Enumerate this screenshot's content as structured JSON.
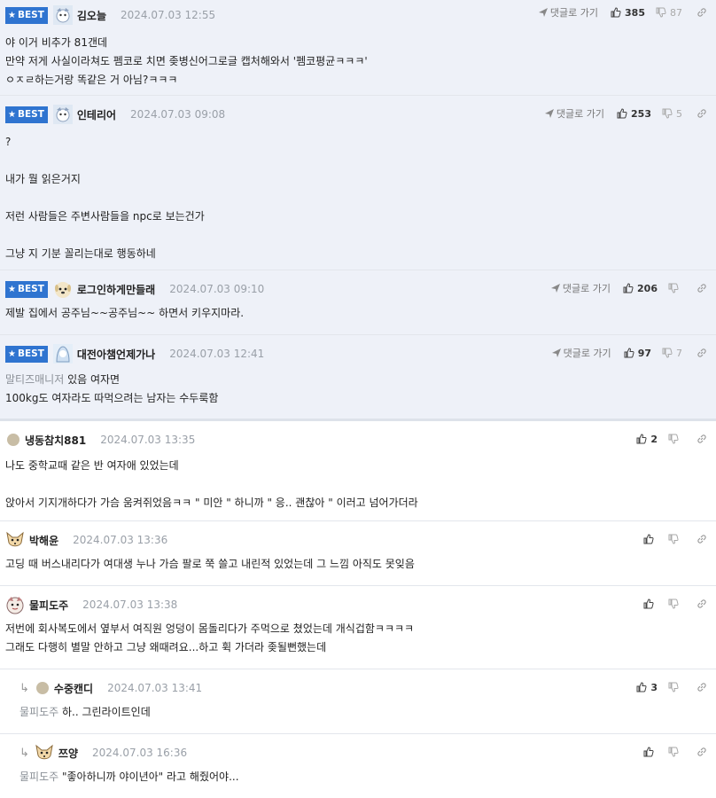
{
  "badge_label": "BEST",
  "reply_label": "댓글로 가기",
  "comments": [
    {
      "nick": "김오늘",
      "date": "2024.07.03 12:55",
      "up": "385",
      "down": "87",
      "lines": [
        "야 이거 비추가 81갠데",
        "만약 저게 사실이라쳐도 펨코로 치면 좆병신어그로글 캡처해와서 '펨코평균ㅋㅋㅋ'",
        "ㅇㅈㄹ하는거랑 똑같은 거 아님?ㅋㅋㅋ"
      ]
    },
    {
      "nick": "인테리어",
      "date": "2024.07.03 09:08",
      "up": "253",
      "down": "5",
      "lines": [
        "?",
        "",
        "내가 뭘 읽은거지",
        "",
        "저런 사람들은 주변사람들을 npc로 보는건가",
        "",
        "그냥 지 기분 꼴리는대로 행동하네"
      ]
    },
    {
      "nick": "로그인하게만들래",
      "date": "2024.07.03 09:10",
      "up": "206",
      "down": "",
      "lines": [
        "제발 집에서 공주님~~공주님~~ 하면서 키우지마라."
      ]
    },
    {
      "nick": "대전아챔언제가나",
      "date": "2024.07.03 12:41",
      "up": "97",
      "down": "7",
      "mention": "말티즈매니저",
      "first_line": " 있음 여자면",
      "lines": [
        "100kg도 여자라도 따먹으려는 남자는 수두룩함"
      ]
    },
    {
      "nick": "냉동참치881",
      "date": "2024.07.03 13:35",
      "up": "2",
      "lines": [
        "나도 중학교때 같은 반 여자애 있었는데",
        "",
        "앉아서 기지개하다가 가슴 움켜쥐었음ㅋㅋ \" 미안 \" 하니까 \" 응.. 괜찮아 \" 이러고 넘어가더라"
      ]
    },
    {
      "nick": "박해윤",
      "date": "2024.07.03 13:36",
      "up": "",
      "lines": [
        "고딩 때 버스내리다가 여대생 누나 가슴 팔로 쭉 쓸고 내린적 있었는데 그 느낌 아직도 못잊음"
      ]
    },
    {
      "nick": "물피도주",
      "date": "2024.07.03 13:38",
      "up": "",
      "lines": [
        "저번에 회사복도에서 옆부서 여직원 엉덩이 몸돌리다가 주먹으로 쳤었는데 개식겁함ㅋㅋㅋㅋ",
        "그래도 다행히 별말 안하고 그냥 왜때려요...하고 휙 가더라 좆될뻔했는데"
      ]
    },
    {
      "nick": "수중캔디",
      "date": "2024.07.03 13:41",
      "up": "3",
      "mention": "물피도주",
      "first_line": " 하.. 그린라이트인데"
    },
    {
      "nick": "쯔양",
      "date": "2024.07.03 16:36",
      "up": "",
      "mention": "물피도주",
      "first_line": " \"좋아하니까 야이년아\" 라고 해줬어야..."
    }
  ]
}
